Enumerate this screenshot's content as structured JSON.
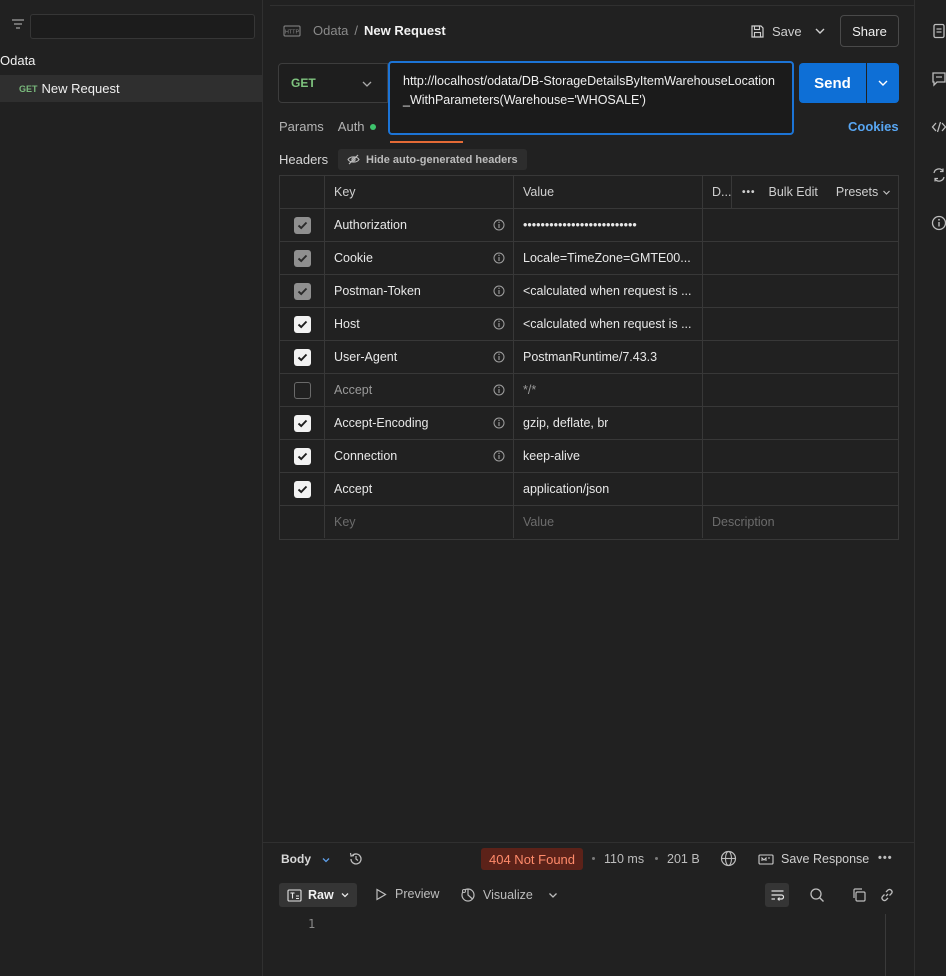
{
  "sidebar": {
    "collection_name": "Odata",
    "request": {
      "method": "GET",
      "name": "New Request"
    }
  },
  "header": {
    "breadcrumb_collection": "Odata",
    "breadcrumb_separator": "/",
    "request_title": "New Request",
    "save_label": "Save",
    "share_label": "Share"
  },
  "request": {
    "method": "GET",
    "url": "http://localhost/odata/DB-StorageDetailsByItemWarehouseLocation_WithParameters(Warehouse='WHOSALE')",
    "send_label": "Send"
  },
  "tabs": {
    "params": "Params",
    "auth": "Auth",
    "cookies": "Cookies"
  },
  "headers_section": {
    "title": "Headers",
    "hide_auto_label": "Hide auto-generated headers",
    "columns": {
      "key": "Key",
      "value": "Value",
      "description": "D...",
      "bulk_edit": "Bulk Edit",
      "presets": "Presets"
    },
    "rows": [
      {
        "key": "Authorization",
        "value": "••••••••••••••••••••••••••",
        "checked": "auto",
        "info": true
      },
      {
        "key": "Cookie",
        "value": "Locale=TimeZone=GMTE00...",
        "checked": "auto",
        "info": true
      },
      {
        "key": "Postman-Token",
        "value": "<calculated when request is ...",
        "checked": "auto",
        "info": true
      },
      {
        "key": "Host",
        "value": "<calculated when request is ...",
        "checked": "on",
        "info": true
      },
      {
        "key": "User-Agent",
        "value": "PostmanRuntime/7.43.3",
        "checked": "on",
        "info": true
      },
      {
        "key": "Accept",
        "value": "*/*",
        "checked": "off",
        "info": true
      },
      {
        "key": "Accept-Encoding",
        "value": "gzip, deflate, br",
        "checked": "on",
        "info": true
      },
      {
        "key": "Connection",
        "value": "keep-alive",
        "checked": "on",
        "info": true
      },
      {
        "key": "Accept",
        "value": "application/json",
        "checked": "on",
        "info": false
      }
    ],
    "placeholders": {
      "key": "Key",
      "value": "Value",
      "description": "Description"
    }
  },
  "response": {
    "body_label": "Body",
    "status": "404 Not Found",
    "time": "110 ms",
    "size": "201 B",
    "save_response_label": "Save Response",
    "raw_label": "Raw",
    "preview_label": "Preview",
    "visualize_label": "Visualize",
    "line_number": "1"
  },
  "colors": {
    "accent_blue": "#0e6fd6",
    "url_border": "#1c74d6",
    "method_green": "#7fc47f",
    "status_error_bg": "#5c2219",
    "status_error_text": "#ff8a6a",
    "active_tab_orange": "#e56b36",
    "auth_dot_green": "#3ec46d"
  }
}
